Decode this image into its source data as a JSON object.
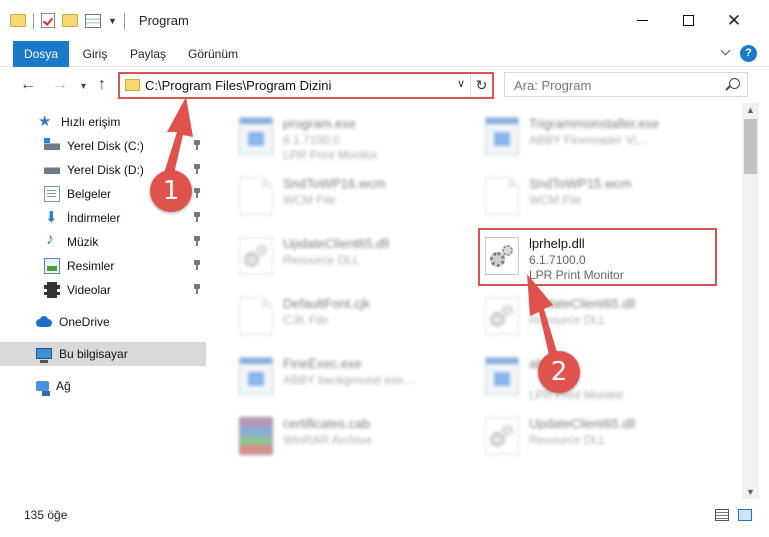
{
  "window": {
    "title": "Program"
  },
  "ribbon": {
    "tabs": [
      {
        "label": "Dosya"
      },
      {
        "label": "Giriş"
      },
      {
        "label": "Paylaş"
      },
      {
        "label": "Görünüm"
      }
    ]
  },
  "nav": {
    "address": "C:\\Program Files\\Program Dizini",
    "search_placeholder": "Ara: Program"
  },
  "sidebar": {
    "items": [
      {
        "label": "Hızlı erişim",
        "icon": "star-icon"
      },
      {
        "label": "Yerel Disk (C:)",
        "icon": "drive-icon",
        "pinned": true
      },
      {
        "label": "Yerel Disk (D:)",
        "icon": "drive-icon",
        "pinned": true
      },
      {
        "label": "Belgeler",
        "icon": "documents-icon",
        "pinned": true
      },
      {
        "label": "İndirmeler",
        "icon": "download-icon",
        "pinned": true
      },
      {
        "label": "Müzik",
        "icon": "music-icon",
        "pinned": true
      },
      {
        "label": "Resimler",
        "icon": "pictures-icon",
        "pinned": true
      },
      {
        "label": "Videolar",
        "icon": "video-icon",
        "pinned": true
      },
      {
        "label": "OneDrive",
        "icon": "onedrive-icon"
      },
      {
        "label": "Bu bilgisayar",
        "icon": "computer-icon",
        "selected": true
      },
      {
        "label": "Ağ",
        "icon": "network-icon"
      }
    ]
  },
  "files": [
    {
      "name": "program.exe",
      "line1": "6.1.7100.0",
      "line2": "LPR Print Monitor",
      "icon": "exe-icon"
    },
    {
      "name": "Trigrammsinstaller.exe",
      "line1": "ABBY Finereader Vi...",
      "line2": "",
      "icon": "exe-icon"
    },
    {
      "name": "SndToWP16.wcm",
      "line1": "WCM File",
      "line2": "",
      "icon": "document-icon"
    },
    {
      "name": "SndToWP15.wcm",
      "line1": "WCM File",
      "line2": "",
      "icon": "document-icon"
    },
    {
      "name": "UpdateClient65.dll",
      "line1": "Resource DLL",
      "line2": "",
      "icon": "dll-icon"
    },
    {
      "name": "lprhelp.dll",
      "line1": "6.1.7100.0",
      "line2": "LPR Print Monitor",
      "icon": "dll-icon"
    },
    {
      "name": "DefaultFont.cjk",
      "line1": "CJK File",
      "line2": "",
      "icon": "document-icon"
    },
    {
      "name": "UpdateClient65.dll",
      "line1": "Resource DLL",
      "line2": "",
      "icon": "dll-icon"
    },
    {
      "name": "FineExec.exe",
      "line1": "ABBY background exe...",
      "line2": "",
      "icon": "exe-icon"
    },
    {
      "name": "ab...",
      "line1": "",
      "line2": "LPR Print Monitor",
      "icon": "exe-icon"
    },
    {
      "name": "certificates.cab",
      "line1": "WinRAR Archive",
      "line2": "",
      "icon": "archive-icon"
    },
    {
      "name": "UpdateClient65.dll",
      "line1": "Resource DLL",
      "line2": "",
      "icon": "dll-icon"
    }
  ],
  "status": {
    "item_count": "135 öğe"
  },
  "annotations": {
    "step1": "1",
    "step2": "2",
    "color": "#e0524c"
  }
}
